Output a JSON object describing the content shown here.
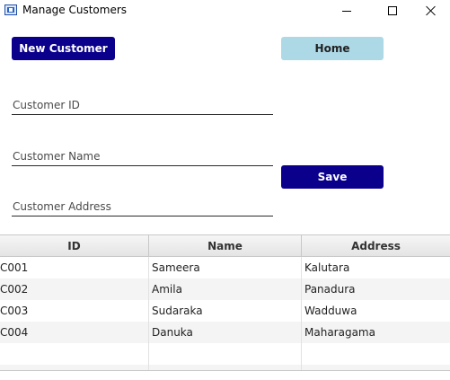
{
  "window": {
    "title": "Manage Customers",
    "icon": "app-icon",
    "controls": [
      "minimize",
      "maximize",
      "close"
    ]
  },
  "toolbar": {
    "new_label": "New Customer",
    "home_label": "Home"
  },
  "form": {
    "id_placeholder": "Customer ID",
    "name_placeholder": "Customer Name",
    "address_placeholder": "Customer Address",
    "save_label": "Save"
  },
  "table": {
    "headers": [
      "ID",
      "Name",
      "Address"
    ],
    "rows": [
      [
        "C001",
        "Sameera",
        "Kalutara"
      ],
      [
        "C002",
        "Amila",
        "Panadura"
      ],
      [
        "C003",
        "Sudaraka",
        "Wadduwa"
      ],
      [
        "C004",
        "Danuka",
        "Maharagama"
      ]
    ]
  },
  "colors": {
    "primary_button": "#0b008c",
    "home_button": "#add8e6"
  }
}
